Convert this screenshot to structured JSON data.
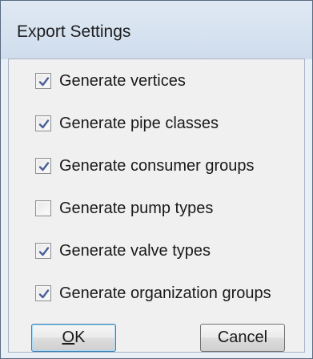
{
  "window": {
    "title": "Export Settings"
  },
  "options": [
    {
      "label": "Generate vertices",
      "checked": true
    },
    {
      "label": "Generate pipe classes",
      "checked": true
    },
    {
      "label": "Generate consumer groups",
      "checked": true
    },
    {
      "label": "Generate pump types",
      "checked": false
    },
    {
      "label": "Generate valve types",
      "checked": true
    },
    {
      "label": "Generate organization groups",
      "checked": true
    }
  ],
  "buttons": {
    "ok_mnemonic": "O",
    "ok_rest": "K",
    "cancel_label": "Cancel"
  },
  "colors": {
    "checkmark": "#4a5f97",
    "titlebar": "#d6e2f0"
  }
}
